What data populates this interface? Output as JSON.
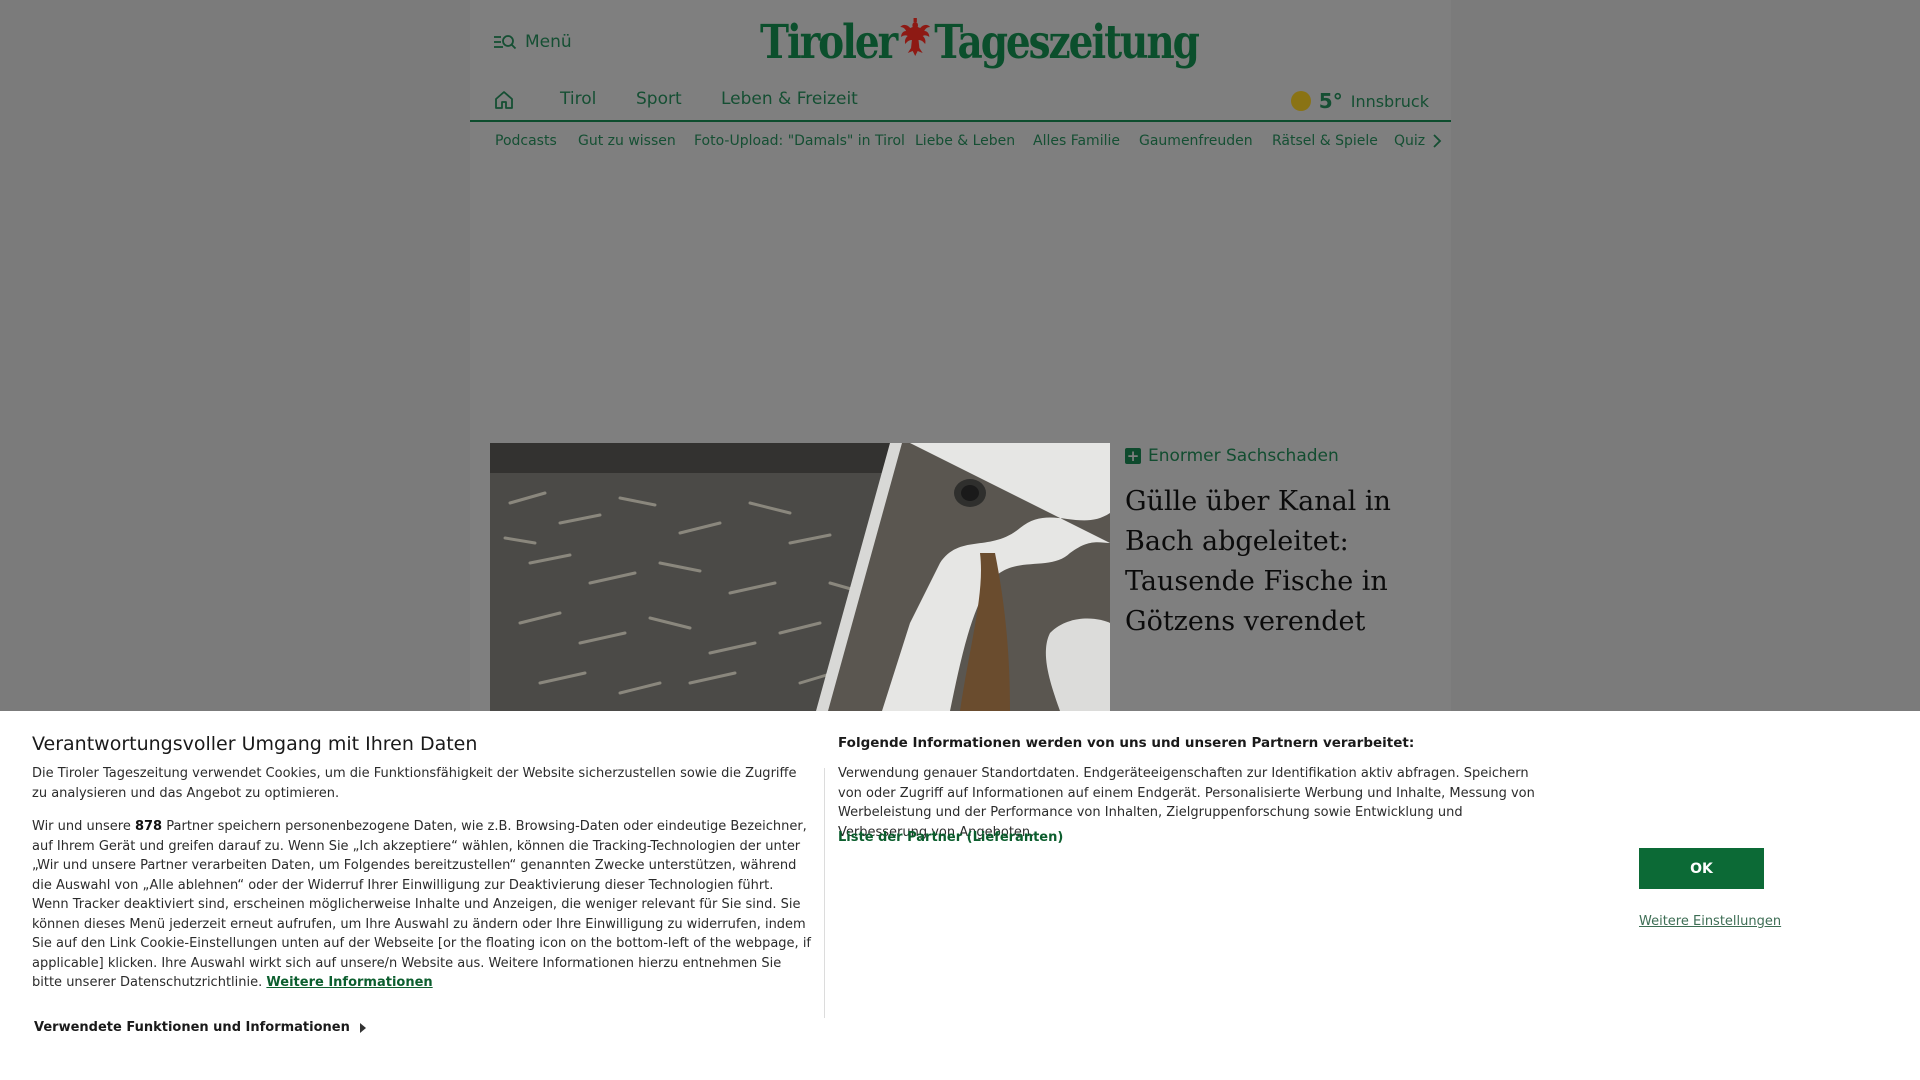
{
  "header": {
    "menu_label": "Menü",
    "logo_left": "Tiroler",
    "logo_right": "Tageszeitung"
  },
  "nav": {
    "items": [
      "Tirol",
      "Sport",
      "Leben & Freizeit"
    ],
    "weather": {
      "temperature": "5°",
      "city": "Innsbruck"
    }
  },
  "subnav": {
    "items": [
      "Podcasts",
      "Gut zu wissen",
      "Foto-Upload: \"Damals\" in Tirol",
      "Liebe & Leben",
      "Alles Familie",
      "Gaumenfreuden",
      "Rätsel & Spiele",
      "Quiz"
    ]
  },
  "article": {
    "kicker": "Enormer Sachschaden",
    "headline": "Gülle über Kanal in Bach abgeleitet: Tausende Fische in Götzens verendet"
  },
  "consent": {
    "title": "Verantwortungsvoller Umgang mit Ihren Daten",
    "intro": "Die Tiroler Tageszeitung verwendet Cookies, um die Funktionsfähigkeit der Website sicherzustellen sowie die Zugriffe zu analysieren und das Angebot zu optimieren.",
    "partners_prefix": "Wir und unsere",
    "partners_count": "878",
    "partners_text": "Partner speichern personenbezogene Daten, wie z.B. Browsing-Daten oder eindeutige Bezeichner, auf Ihrem Gerät und greifen darauf zu. Wenn Sie „Ich akzeptiere“ wählen, können die Tracking-Technologien der unter „Wir und unsere Partner verarbeiten Daten, um Folgendes bereitzustellen“ genannten Zwecke unterstützen, während die Auswahl von „Alle ablehnen“ oder der Widerruf Ihrer Einwilligung zur Deaktivierung dieser Technologien führt. Wenn Tracker deaktiviert sind, erscheinen möglicherweise Inhalte und Anzeigen, die weniger relevant für Sie sind. Sie können dieses Menü jederzeit erneut aufrufen, um Ihre Auswahl zu ändern oder Ihre Einwilligung zu widerrufen, indem Sie auf den Link Cookie-Einstellungen unten auf der Webseite [or the floating icon on the bottom-left of the webpage, if applicable] klicken. Ihre Auswahl wirkt sich auf unsere/n Website aus. Weitere Informationen hierzu entnehmen Sie bitte unserer Datenschutzrichtlinie.",
    "more_info_link": "Weitere Informationen",
    "used_functions": "Verwendete Funktionen und Informationen",
    "right_title": "Folgende Informationen werden von uns und unseren Partnern verarbeitet:",
    "right_text": "Verwendung genauer Standortdaten. Endgeräteeigenschaften zur Identifikation aktiv abfragen. Speichern von oder Zugriff auf Informationen auf einem Endgerät. Personalisierte Werbung und Inhalte, Messung von Werbeleistung und der Performance von Inhalten, Zielgruppenforschung sowie Entwicklung und Verbesserung von Angeboten.",
    "partner_list_link": "Liste der Partner (Lieferanten)",
    "ok_label": "OK",
    "settings_link": "Weitere Einstellungen"
  },
  "colors": {
    "brand_green": "#0c6a36",
    "overlay_gray": "#7f7f7f"
  }
}
